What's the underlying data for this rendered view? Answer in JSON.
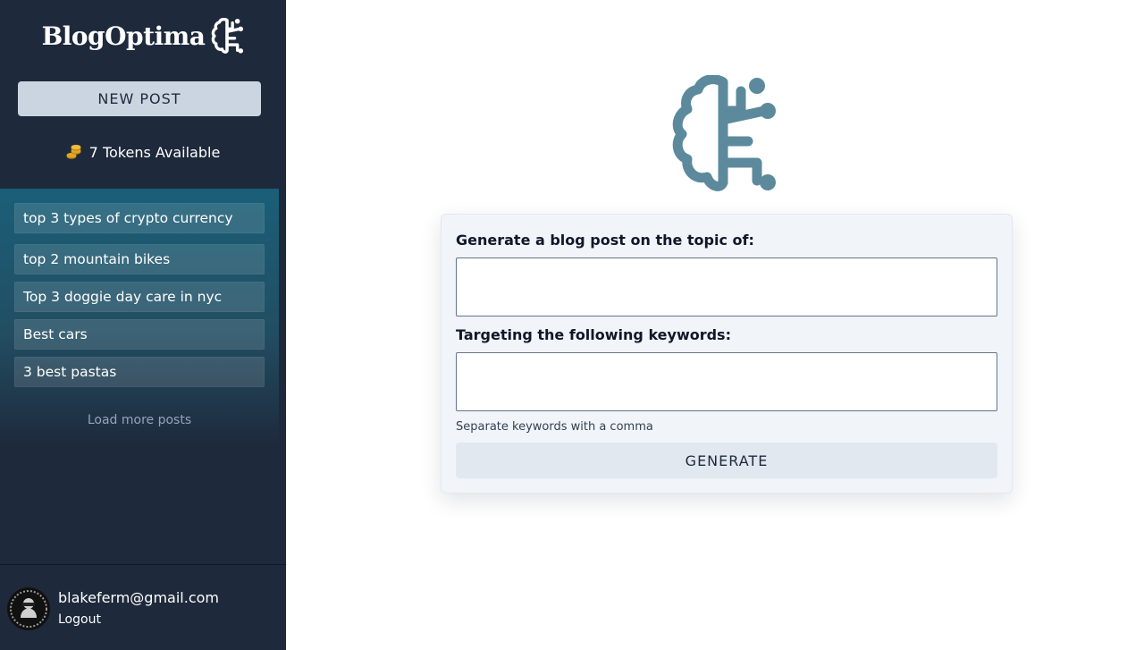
{
  "app": {
    "brand": "BlogOptima",
    "logo_icon": "brain-circuit-icon"
  },
  "sidebar": {
    "new_post_label": "NEW POST",
    "tokens": {
      "icon": "coins-icon",
      "text": "7 Tokens Available"
    },
    "posts": [
      "top 3 types of crypto currency",
      "top 2 mountain bikes",
      "Top 3 doggie day care in nyc",
      "Best cars",
      "3 best pastas"
    ],
    "load_more_label": "Load more posts",
    "user": {
      "email": "blakeferm@gmail.com",
      "logout_label": "Logout"
    }
  },
  "form": {
    "topic_label": "Generate a blog post on the topic of:",
    "topic_value": "",
    "keywords_label": "Targeting the following keywords:",
    "keywords_value": "",
    "helper_text": "Separate keywords with a comma",
    "generate_label": "GENERATE"
  },
  "colors": {
    "sidebar_bg": "#1e293b",
    "accent_logo": "#5c8a9c",
    "posts_gradient_top": "#1a5f78",
    "button_light": "#cbd5e1",
    "card_bg": "#f1f5f9",
    "coin": "#e0a722"
  }
}
